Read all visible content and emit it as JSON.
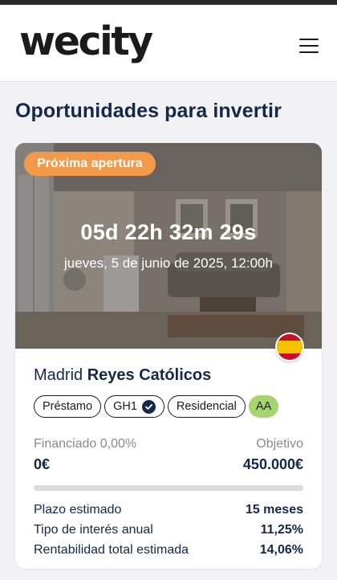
{
  "header": {
    "logo": "wecity",
    "menu_icon": "hamburger-menu-icon"
  },
  "page": {
    "title": "Oportunidades para invertir"
  },
  "card": {
    "status_badge": "Próxima apertura",
    "countdown": "05d 22h 32m 29s",
    "open_date": "jueves, 5 de junio de 2025, 12:00h",
    "country_flag": "spain-flag-icon",
    "city": "Madrid",
    "name": "Reyes Católicos",
    "tags": [
      "Préstamo",
      "GH1",
      "Residencial"
    ],
    "rating": "AA",
    "funded_label": "Financiado",
    "funded_percent": "0,00%",
    "funded_amount": "0€",
    "goal_label": "Objetivo",
    "goal_amount": "450.000€",
    "progress_percent": 0,
    "stats": [
      {
        "label": "Plazo estimado",
        "value": "15 meses"
      },
      {
        "label": "Tipo de interés anual",
        "value": "11,25%"
      },
      {
        "label": "Rentabilidad total estimada",
        "value": "14,06%"
      }
    ]
  },
  "colors": {
    "brand_navy": "#13284a",
    "badge_orange": "#f39a4a",
    "rating_green": "#a8d46f"
  }
}
